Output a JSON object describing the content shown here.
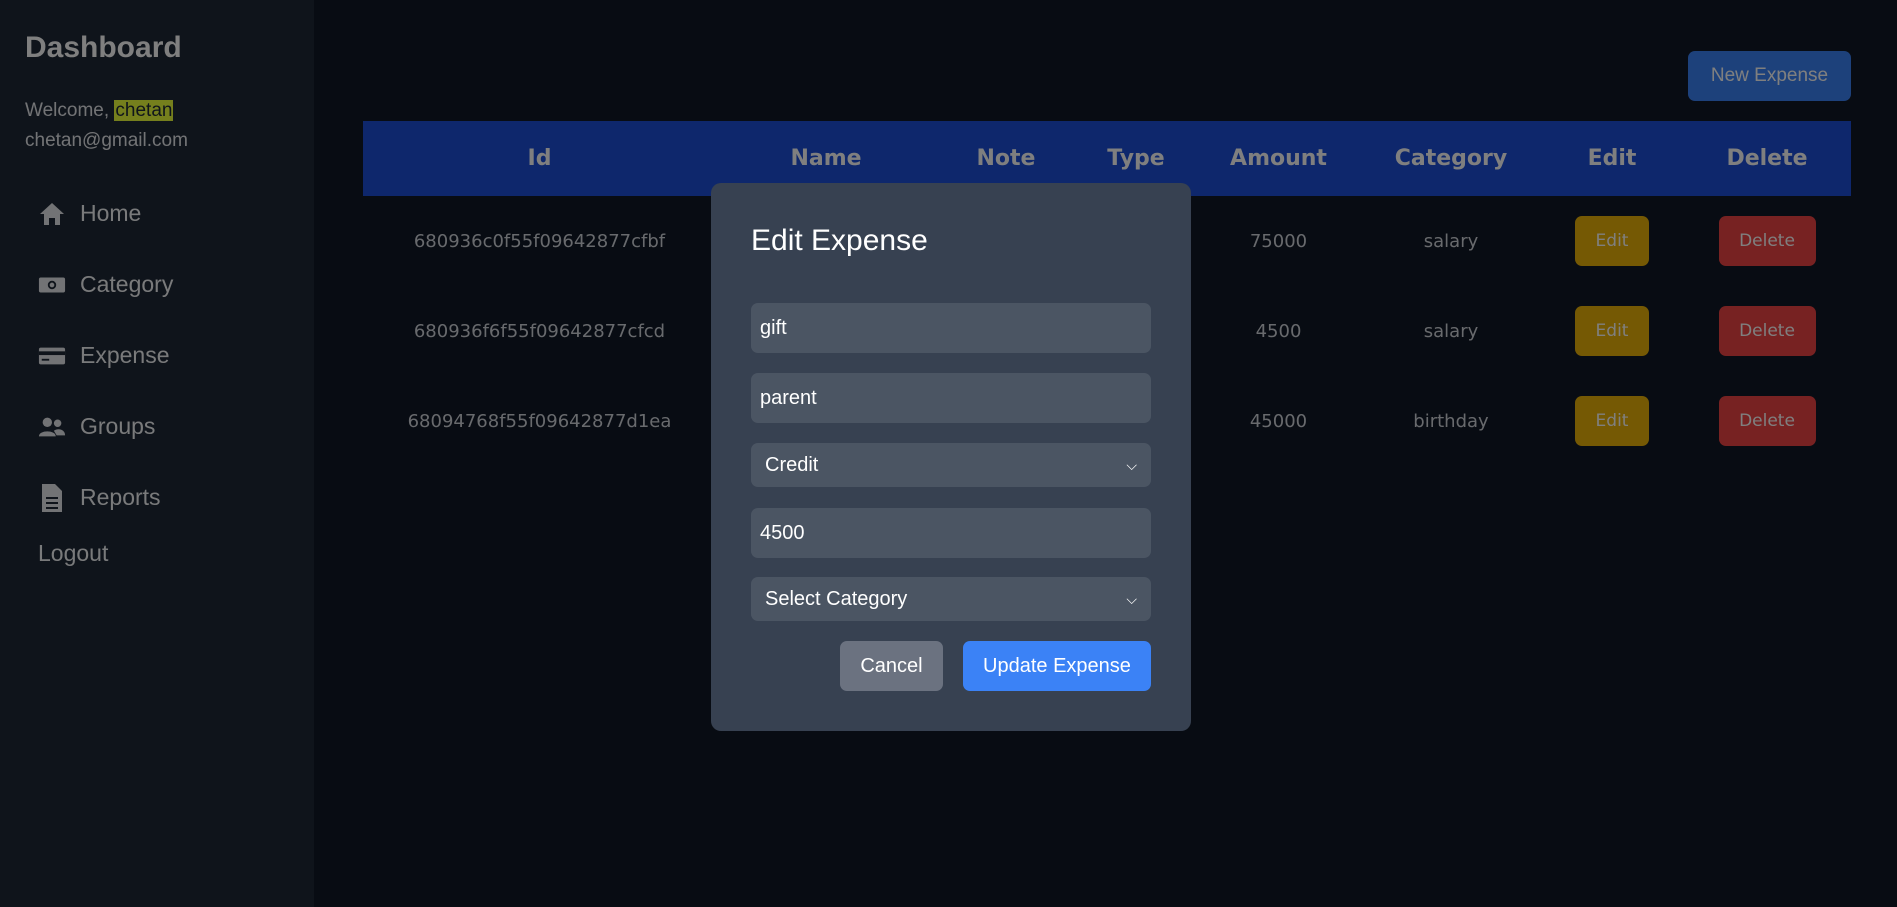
{
  "sidebar": {
    "title": "Dashboard",
    "welcome_prefix": "Welcome,",
    "user_name": "chetan",
    "email": "chetan@gmail.com",
    "items": [
      {
        "label": "Home",
        "icon": "home-icon"
      },
      {
        "label": "Category",
        "icon": "money-icon"
      },
      {
        "label": "Expense",
        "icon": "credit-card-icon"
      },
      {
        "label": "Groups",
        "icon": "users-icon"
      },
      {
        "label": "Reports",
        "icon": "document-icon"
      }
    ],
    "logout": "Logout"
  },
  "main": {
    "new_expense_label": "New Expense",
    "table": {
      "columns": [
        "Id",
        "Name",
        "Note",
        "Type",
        "Amount",
        "Category",
        "Edit",
        "Delete"
      ],
      "rows": [
        {
          "id": "680936c0f55f09642877cfbf",
          "name": "",
          "note": "",
          "type": "",
          "amount": "75000",
          "category": "salary",
          "edit": "Edit",
          "delete": "Delete"
        },
        {
          "id": "680936f6f55f09642877cfcd",
          "name": "",
          "note": "",
          "type": "",
          "amount": "4500",
          "category": "salary",
          "edit": "Edit",
          "delete": "Delete"
        },
        {
          "id": "68094768f55f09642877d1ea",
          "name": "",
          "note": "",
          "type": "",
          "amount": "45000",
          "category": "birthday",
          "edit": "Edit",
          "delete": "Delete"
        }
      ]
    }
  },
  "modal": {
    "title": "Edit Expense",
    "name_value": "gift",
    "note_value": "parent",
    "type_value": "Credit",
    "amount_value": "4500",
    "category_value": "Select Category",
    "cancel_label": "Cancel",
    "update_label": "Update Expense"
  },
  "colors": {
    "background": "#111827",
    "sidebar": "#1f2937",
    "accent_blue": "#3b82f6",
    "table_header": "#1d4ed8",
    "edit_yellow": "#eab308",
    "delete_red": "#ef4444",
    "modal_bg": "#374151",
    "input_bg": "#4b5563",
    "cancel_gray": "#6b7280"
  }
}
